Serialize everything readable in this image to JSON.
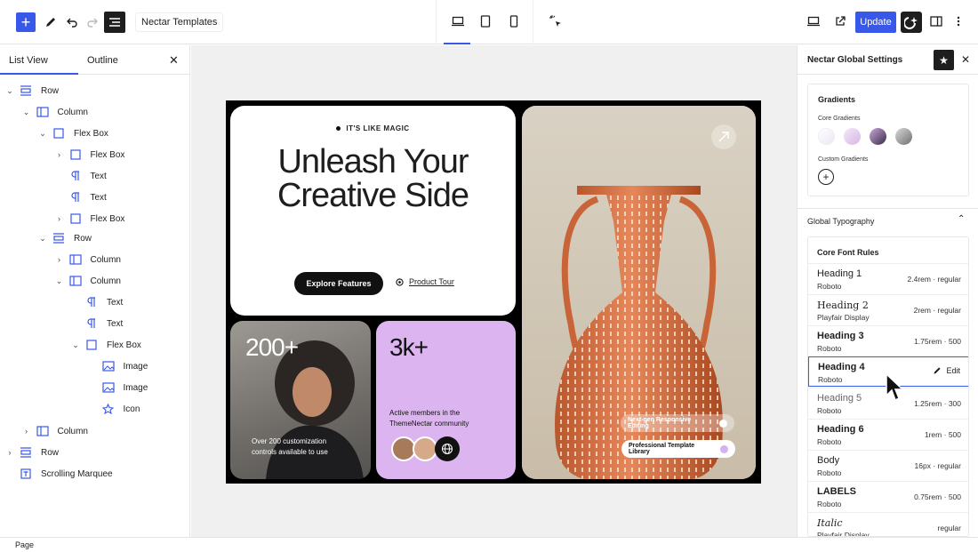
{
  "topbar": {
    "document_title": "Nectar Templates",
    "update_label": "Update",
    "icons": [
      "plus-icon",
      "pencil-icon",
      "undo-icon",
      "redo-icon",
      "list-view-icon",
      "desktop-icon",
      "tablet-icon",
      "mobile-icon",
      "sparkle-cursor-icon",
      "view-icon",
      "external-link-icon",
      "nectar-logo-icon",
      "sidebar-toggle-icon",
      "more-vertical-icon"
    ],
    "accent_color": "#3858e9"
  },
  "left_panel": {
    "tabs": [
      "List View",
      "Outline"
    ],
    "active_tab": "List View",
    "tree": [
      {
        "label": "Row",
        "icon": "row-icon",
        "depth": 0,
        "chevron": "open"
      },
      {
        "label": "Column",
        "icon": "column-icon",
        "depth": 1,
        "chevron": "open"
      },
      {
        "label": "Flex Box",
        "icon": "flexbox-icon",
        "depth": 2,
        "chevron": "open"
      },
      {
        "label": "Flex Box",
        "icon": "flexbox-icon",
        "depth": 3,
        "chevron": "closed"
      },
      {
        "label": "Text",
        "icon": "paragraph-icon",
        "depth": 3,
        "chevron": "none"
      },
      {
        "label": "Text",
        "icon": "paragraph-icon",
        "depth": 3,
        "chevron": "none"
      },
      {
        "label": "Flex Box",
        "icon": "flexbox-icon",
        "depth": 3,
        "chevron": "closed"
      },
      {
        "label": "Row",
        "icon": "row-icon",
        "depth": 2,
        "chevron": "open"
      },
      {
        "label": "Column",
        "icon": "column-icon",
        "depth": 3,
        "chevron": "closed"
      },
      {
        "label": "Column",
        "icon": "column-icon",
        "depth": 3,
        "chevron": "open"
      },
      {
        "label": "Text",
        "icon": "paragraph-icon",
        "depth": 4,
        "chevron": "none"
      },
      {
        "label": "Text",
        "icon": "paragraph-icon",
        "depth": 4,
        "chevron": "none"
      },
      {
        "label": "Flex Box",
        "icon": "flexbox-icon",
        "depth": 4,
        "chevron": "open"
      },
      {
        "label": "Image",
        "icon": "image-icon",
        "depth": 5,
        "chevron": "none"
      },
      {
        "label": "Image",
        "icon": "image-icon",
        "depth": 5,
        "chevron": "none"
      },
      {
        "label": "Icon",
        "icon": "star-icon",
        "depth": 5,
        "chevron": "none"
      },
      {
        "label": "Column",
        "icon": "column-icon",
        "depth": 1,
        "chevron": "closed"
      },
      {
        "label": "Row",
        "icon": "row-icon",
        "depth": 0,
        "chevron": "closed"
      },
      {
        "label": "Scrolling Marquee",
        "icon": "marquee-icon",
        "depth": 0,
        "chevron": "none"
      }
    ]
  },
  "canvas": {
    "eyebrow": "IT'S LIKE MAGIC",
    "hero_line1": "Unleash Your",
    "hero_line2": "Creative Side",
    "explore_label": "Explore Features",
    "tour_label": "Product Tour",
    "stat1_number": "200+",
    "stat1_caption": "Over 200 customization controls available to use",
    "stat2_number": "3k+",
    "stat2_caption": "Active members in the ThemeNectar community",
    "chip1": "Next-gen Responsive Editing",
    "chip2": "Professional Template Library"
  },
  "right_panel": {
    "title": "Nectar Global Settings",
    "gradients_title": "Gradients",
    "core_gradients_label": "Core Gradients",
    "custom_gradients_label": "Custom Gradients",
    "typography_title": "Global Typography",
    "core_font_rules": "Core Font Rules",
    "edit_label": "Edit",
    "font_rules": [
      {
        "name": "Heading 1",
        "family": "Roboto",
        "size": "2.4rem",
        "weight": "regular"
      },
      {
        "name": "Heading 2",
        "family": "Playfair Display",
        "size": "2rem",
        "weight": "regular"
      },
      {
        "name": "Heading 3",
        "family": "Roboto",
        "size": "1.75rem",
        "weight": "500"
      },
      {
        "name": "Heading 4",
        "family": "Roboto",
        "size": "",
        "weight": ""
      },
      {
        "name": "Heading 5",
        "family": "Roboto",
        "size": "1.25rem",
        "weight": "300"
      },
      {
        "name": "Heading 6",
        "family": "Roboto",
        "size": "1rem",
        "weight": "500"
      },
      {
        "name": "Body",
        "family": "Roboto",
        "size": "16px",
        "weight": "regular"
      },
      {
        "name": "LABELS",
        "family": "Roboto",
        "size": "0.75rem",
        "weight": "500"
      },
      {
        "name": "Italic",
        "family": "Playfair Display",
        "size": "",
        "weight": "regular"
      }
    ]
  },
  "bottom_bar": {
    "breadcrumb": "Page"
  }
}
